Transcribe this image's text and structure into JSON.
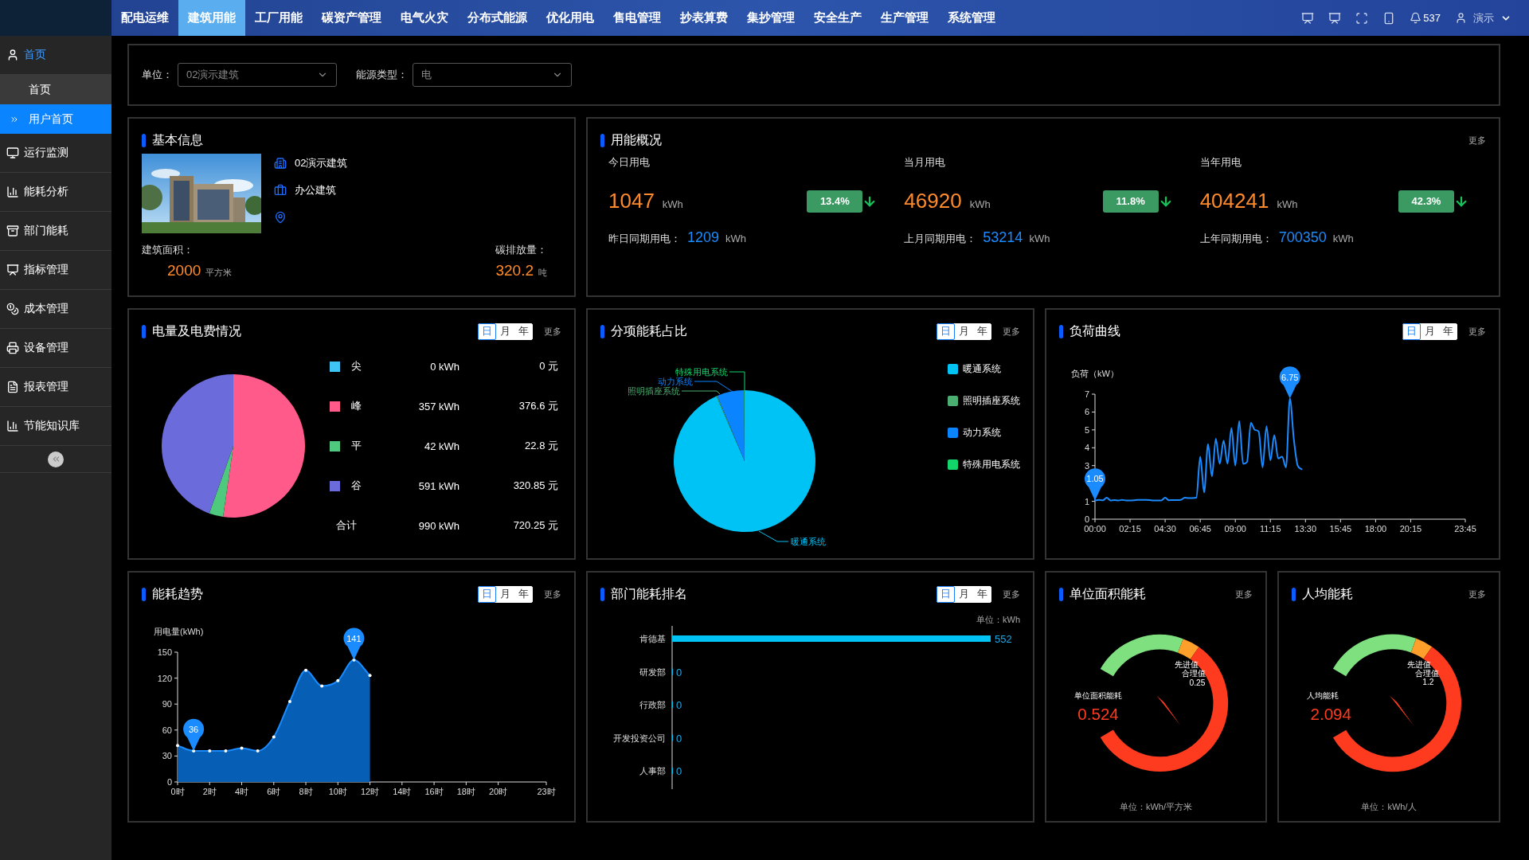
{
  "top_nav": {
    "items": [
      {
        "label": "配电运维",
        "selected": false
      },
      {
        "label": "建筑用能",
        "selected": true
      },
      {
        "label": "工厂用能",
        "selected": false
      },
      {
        "label": "碳资产管理",
        "selected": false
      },
      {
        "label": "电气火灾",
        "selected": false
      },
      {
        "label": "分布式能源",
        "selected": false
      },
      {
        "label": "优化用电",
        "selected": false
      },
      {
        "label": "售电管理",
        "selected": false
      },
      {
        "label": "抄表算费",
        "selected": false
      },
      {
        "label": "集抄管理",
        "selected": false
      },
      {
        "label": "安全生产",
        "selected": false
      },
      {
        "label": "生产管理",
        "selected": false
      },
      {
        "label": "系统管理",
        "selected": false
      }
    ],
    "badge_count": "537",
    "user": "演示"
  },
  "sidebar": {
    "items": [
      {
        "label": "首页",
        "expanded": true,
        "children": [
          {
            "label": "首页",
            "selected": false
          },
          {
            "label": "用户首页",
            "selected": true
          }
        ]
      },
      {
        "label": "运行监测",
        "expanded": false
      },
      {
        "label": "能耗分析",
        "expanded": false
      },
      {
        "label": "部门能耗",
        "expanded": false
      },
      {
        "label": "指标管理",
        "expanded": false
      },
      {
        "label": "成本管理",
        "expanded": false
      },
      {
        "label": "设备管理",
        "expanded": false
      },
      {
        "label": "报表管理",
        "expanded": false
      },
      {
        "label": "节能知识库",
        "expanded": false
      }
    ]
  },
  "filters": [
    {
      "label": "单位：",
      "value": "02演示建筑"
    },
    {
      "label": "能源类型：",
      "value": "电"
    }
  ],
  "basic_info": {
    "title": "基本信息",
    "name": "02演示建筑",
    "building_type": "办公建筑",
    "stats": [
      {
        "label": "建筑面积：",
        "value": "2000",
        "unit": "平方米"
      },
      {
        "label": "碳排放量：",
        "value": "320.2",
        "unit": "吨"
      }
    ]
  },
  "usage": {
    "title": "用能概况",
    "more": "更多",
    "columns": [
      {
        "label": "今日用电",
        "value": "1047",
        "unit": "kWh",
        "change": "13.4%",
        "decreased": true,
        "compare_label": "昨日同期用电：",
        "compare_value": "1209",
        "compare_unit": "kWh"
      },
      {
        "label": "当月用电",
        "value": "46920",
        "unit": "kWh",
        "change": "11.8%",
        "decreased": true,
        "compare_label": "上月同期用电：",
        "compare_value": "53214",
        "compare_unit": "kWh"
      },
      {
        "label": "当年用电",
        "value": "404241",
        "unit": "kWh",
        "change": "42.3%",
        "decreased": true,
        "compare_label": "上年同期用电：",
        "compare_value": "700350",
        "compare_unit": "kWh"
      }
    ]
  },
  "energy_cost": {
    "title": "电量及电费情况",
    "periods": [
      {
        "label": "日",
        "selected": true
      },
      {
        "label": "月",
        "selected": false
      },
      {
        "label": "年",
        "selected": false
      }
    ],
    "more": "更多",
    "chart_data": {
      "type": "pie",
      "categories": [
        "尖",
        "峰",
        "平",
        "谷"
      ],
      "values": [
        0,
        52.29,
        3.17,
        44.54
      ]
    },
    "legend": [
      {
        "kwh": "0 kWh",
        "cost": "0 元",
        "color": "#3ec5f5"
      },
      {
        "kwh": "357 kWh",
        "cost": "376.6 元",
        "color": "#ff5a8a"
      },
      {
        "kwh": "42 kWh",
        "cost": "22.8 元",
        "color": "#4fc97e"
      },
      {
        "kwh": "591 kWh",
        "cost": "320.85 元",
        "color": "#6b6bdb"
      }
    ],
    "total": {
      "label": "合计",
      "kwh": "990 kWh",
      "cost": "720.25 元"
    }
  },
  "subitem_share": {
    "title": "分项能耗占比",
    "periods": [
      {
        "label": "日",
        "selected": true
      },
      {
        "label": "月",
        "selected": false
      },
      {
        "label": "年",
        "selected": false
      }
    ],
    "more": "更多",
    "legend": [
      {
        "label": "暖通系统",
        "color": "#00c3f5"
      },
      {
        "label": "照明插座系统",
        "color": "#4caf72"
      },
      {
        "label": "动力系统",
        "color": "#0a84ff"
      },
      {
        "label": "特殊用电系统",
        "color": "#13d66a"
      }
    ],
    "callouts": [
      {
        "label": "特殊用电系统"
      },
      {
        "label": "动力系统"
      },
      {
        "label": "照明插座系统"
      },
      {
        "label": "暖通系统"
      }
    ]
  },
  "load_curve": {
    "title": "负荷曲线",
    "periods": [
      {
        "label": "日",
        "selected": true
      },
      {
        "label": "月",
        "selected": false
      },
      {
        "label": "年",
        "selected": false
      }
    ],
    "more": "更多",
    "chart_data": {
      "type": "line",
      "ylabel": "负荷（kW）",
      "ylim": [
        0,
        7
      ],
      "yticks": [
        0,
        1,
        3,
        4,
        5,
        6,
        7
      ],
      "categories": [
        "00:00",
        null,
        null,
        null,
        null,
        null,
        null,
        null,
        null,
        "02:15",
        null,
        null,
        null,
        null,
        null,
        null,
        null,
        null,
        "04:30",
        null,
        null,
        null,
        null,
        null,
        null,
        null,
        null,
        "06:45",
        null,
        null,
        null,
        null,
        null,
        null,
        null,
        null,
        "09:00",
        null,
        null,
        null,
        null,
        null,
        null,
        null,
        null,
        "11:15",
        null,
        null,
        null,
        null,
        null,
        null,
        null,
        null,
        "13:30",
        null,
        null,
        null,
        null,
        null,
        null,
        null,
        null,
        "15:45",
        null,
        null,
        null,
        null,
        null,
        null,
        null,
        null,
        "18:00",
        null,
        null,
        null,
        null,
        null,
        null,
        null,
        null,
        "20:15",
        null,
        null,
        null,
        null,
        null,
        null,
        null,
        null,
        null,
        null,
        null,
        null,
        null,
        "23:45"
      ],
      "values": [
        1.05,
        1.08,
        1.06,
        1.2,
        1.05,
        1.07,
        1.05,
        1.08,
        1.05,
        1.05,
        1.06,
        1.08,
        1.08,
        1.08,
        1.07,
        1.05,
        1.05,
        1.05,
        1.2,
        1.06,
        1.07,
        1.07,
        1.08,
        1.2,
        1.18,
        1.18,
        1.2,
        3.5,
        1.5,
        4.2,
        2.4,
        4.5,
        3.1,
        4.4,
        3.1,
        5.1,
        3.0,
        5.5,
        3.1,
        3.2,
        5.4,
        5.0,
        4.9,
        2.9,
        5.2,
        3.3,
        4.7,
        3.4,
        3.5,
        2.9,
        6.75,
        4.5,
        3.0,
        2.8,
        null,
        null,
        null,
        null,
        null,
        null,
        null,
        null,
        null,
        null,
        null,
        null,
        null,
        null,
        null,
        null,
        null,
        null,
        null,
        null,
        null,
        null,
        null,
        null,
        null,
        null,
        null,
        null,
        null,
        null,
        null,
        null,
        null,
        null,
        null,
        null,
        null,
        null,
        null,
        null,
        null,
        null
      ],
      "annotations": [
        {
          "y": 1.05,
          "text": "1.05"
        },
        {
          "y": 6.75,
          "text": "6.75"
        }
      ]
    }
  },
  "trend": {
    "title": "能耗趋势",
    "periods": [
      {
        "label": "日",
        "selected": true
      },
      {
        "label": "月",
        "selected": false
      },
      {
        "label": "年",
        "selected": false
      }
    ],
    "more": "更多",
    "chart_data": {
      "type": "area",
      "ylabel": "用电量(kWh)",
      "xlim": [
        0,
        23
      ],
      "ylim": [
        0,
        150
      ],
      "yticks": [
        0,
        30,
        60,
        90,
        120,
        150
      ],
      "xticks": [
        {
          "value": 0,
          "label": "0时"
        },
        {
          "value": 2,
          "label": "2时"
        },
        {
          "value": 4,
          "label": "4时"
        },
        {
          "value": 6,
          "label": "6时"
        },
        {
          "value": 8,
          "label": "8时"
        },
        {
          "value": 10,
          "label": "10时"
        },
        {
          "value": 12,
          "label": "12时"
        },
        {
          "value": 14,
          "label": "14时"
        },
        {
          "value": 16,
          "label": "16时"
        },
        {
          "value": 18,
          "label": "18时"
        },
        {
          "value": 20,
          "label": "20时"
        },
        {
          "value": 23,
          "label": "23时"
        }
      ],
      "x": [
        0,
        1,
        2,
        3,
        4,
        5,
        6,
        7,
        8,
        9,
        10,
        11,
        12
      ],
      "values": [
        42,
        36,
        36,
        36,
        39,
        36,
        52,
        93,
        129,
        111,
        117,
        141,
        123
      ],
      "annotations": [
        {
          "x": 1,
          "y": 36,
          "text": "36"
        },
        {
          "x": 11,
          "y": 141,
          "text": "141"
        }
      ]
    }
  },
  "dept_ranking": {
    "title": "部门能耗排名",
    "periods": [
      {
        "label": "日",
        "selected": true
      },
      {
        "label": "月",
        "selected": false
      },
      {
        "label": "年",
        "selected": false
      }
    ],
    "more": "更多",
    "unit": "单位：kWh",
    "chart_data": {
      "type": "bar",
      "orientation": "horizontal",
      "categories": [
        "肯德基",
        "研发部",
        "行政部",
        "开发投资公司",
        "人事部"
      ],
      "values": [
        552,
        0,
        0,
        0,
        0
      ],
      "value_labels": [
        "552",
        "0",
        "0",
        "0",
        "0"
      ]
    }
  },
  "gauges": [
    {
      "title": "单位面积能耗",
      "more": "更多",
      "name": "单位面积能耗",
      "value": "0.524",
      "thresholds": [
        "先进值",
        "合理值"
      ],
      "threshold_value": "0.25",
      "unit": "单位：kWh/平方米"
    },
    {
      "title": "人均能耗",
      "more": "更多",
      "name": "人均能耗",
      "value": "2.094",
      "thresholds": [
        "先进值",
        "合理值"
      ],
      "threshold_value": "1.2",
      "unit": "单位：kWh/人"
    }
  ]
}
